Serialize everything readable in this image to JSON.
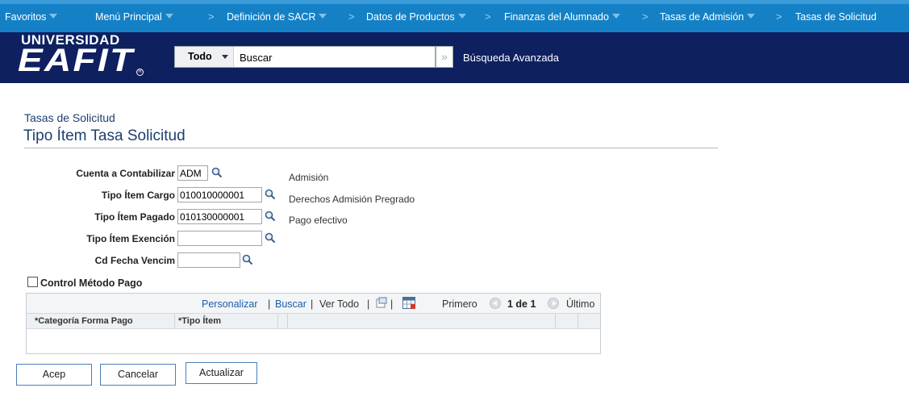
{
  "nav": {
    "items": [
      {
        "label": "Favoritos",
        "dropdown": true
      },
      {
        "label": "Menú Principal",
        "dropdown": true
      },
      {
        "label": "Definición de SACR",
        "dropdown": true
      },
      {
        "label": "Datos de Productos",
        "dropdown": true
      },
      {
        "label": "Finanzas del Alumnado",
        "dropdown": true
      },
      {
        "label": "Tasas de Admisión",
        "dropdown": true
      },
      {
        "label": "Tasas de Solicitud",
        "dropdown": false
      }
    ],
    "separator": ">"
  },
  "header": {
    "logo_top": "UNIVERSIDAD",
    "logo_big": "EAFIT",
    "logo_reg": "R",
    "search_scope": "Todo",
    "search_value": "Buscar",
    "search_go": "»",
    "advanced_search": "Búsqueda Avanzada"
  },
  "page": {
    "subtitle": "Tasas de Solicitud",
    "title": "Tipo Ítem Tasa Solicitud"
  },
  "form": {
    "cuenta": {
      "label": "Cuenta a Contabilizar",
      "value": "ADM",
      "description": "Admisión"
    },
    "cargo": {
      "label": "Tipo Ítem Cargo",
      "value": "010010000001",
      "description": "Derechos Admisión Pregrado"
    },
    "pagado": {
      "label": "Tipo Ítem Pagado",
      "value": "010130000001",
      "description": "Pago efectivo"
    },
    "exencion": {
      "label": "Tipo Ítem Exención",
      "value": ""
    },
    "fecha": {
      "label": "Cd Fecha Vencim",
      "value": ""
    },
    "control_metodo": {
      "label": "Control Método Pago",
      "checked": false
    }
  },
  "grid": {
    "toolbar": {
      "personalizar": "Personalizar",
      "sep": "|",
      "buscar": "Buscar",
      "ver_todo": "Ver Todo",
      "primero": "Primero",
      "page": "1 de 1",
      "ultimo": "Último"
    },
    "columns": [
      "*Categoría Forma Pago",
      "*Tipo Ítem"
    ]
  },
  "buttons": {
    "acep": "Acep",
    "cancelar": "Cancelar",
    "actualizar": "Actualizar"
  },
  "colors": {
    "nav_bg": "#1481c6",
    "header_bg": "#0f2060",
    "title": "#1c3f6e",
    "link": "#1a5fa5"
  }
}
